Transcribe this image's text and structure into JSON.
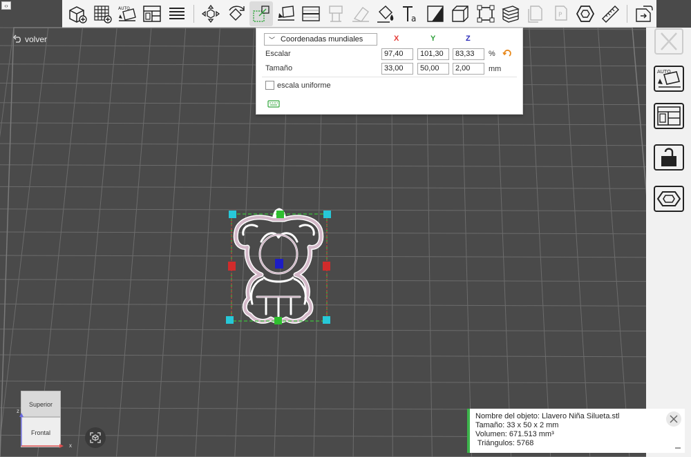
{
  "toolbar": {
    "items": [
      {
        "name": "add-object-icon"
      },
      {
        "name": "add-array-icon"
      },
      {
        "name": "auto-place-icon"
      },
      {
        "name": "arrange-layout-icon"
      },
      {
        "name": "list-objects-icon"
      },
      {
        "name": "move-tool-icon"
      },
      {
        "name": "rotate-tool-icon"
      },
      {
        "name": "scale-tool-icon"
      },
      {
        "name": "place-on-face-icon"
      },
      {
        "name": "split-tool-icon"
      },
      {
        "name": "support-tool-icon"
      },
      {
        "name": "erase-tool-icon"
      },
      {
        "name": "paint-bucket-icon"
      },
      {
        "name": "text-tool-icon"
      },
      {
        "name": "cut-corner-icon"
      },
      {
        "name": "box-hollow-icon"
      },
      {
        "name": "bounding-box-icon"
      },
      {
        "name": "layers-icon"
      },
      {
        "name": "copy-icon"
      },
      {
        "name": "paste-icon"
      },
      {
        "name": "hexagon-icon"
      },
      {
        "name": "measure-ruler-icon"
      },
      {
        "name": "export-icon"
      }
    ]
  },
  "back_label": "volver",
  "scale_panel": {
    "coord_mode": "Coordenadas mundiales",
    "axes": [
      "X",
      "Y",
      "Z"
    ],
    "axis_colors": {
      "x": "#e53935",
      "y": "#2e9e3a",
      "z": "#2b2bb8"
    },
    "scale_label": "Escalar",
    "scale_values": [
      "97,40",
      "101,30",
      "83,33"
    ],
    "scale_unit": "%",
    "size_label": "Tamaño",
    "size_values": [
      "33,00",
      "50,00",
      "2,00"
    ],
    "size_unit": "mm",
    "uniform_label": "escala uniforme",
    "uniform_checked": false
  },
  "view_cube": {
    "top_label": "Superior",
    "front_label": "Frontal",
    "axis_x": "x",
    "axis_z": "z"
  },
  "info_card": {
    "name_line": "Nombre del objeto: Llavero Niña Silueta.stl",
    "size_line": "Tamaño: 33 x 50 x 2 mm",
    "volume_line": "Volumen: 671.513 mm³",
    "triangles_line": " Triángulos: 5768",
    "accent": "#3cb44b"
  }
}
